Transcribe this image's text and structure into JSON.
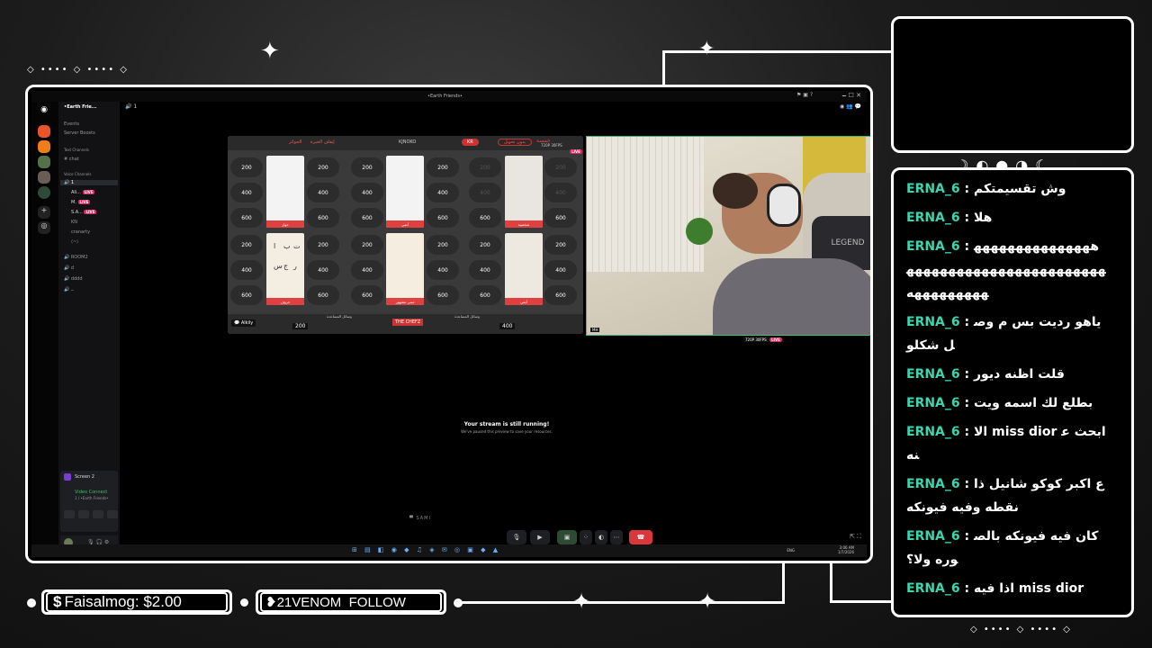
{
  "discord": {
    "window_title": "•Earth Friends•",
    "server_name": "•Earth Frie...",
    "sidebar_items": [
      "Events",
      "Server Boosts"
    ],
    "text_channels_header": "Text Channels",
    "text_channels": [
      "chat"
    ],
    "voice_channels_header": "Voice Channels",
    "voice_channel_active": "1",
    "voice_users": [
      "Ali...",
      "M.",
      "S.A...",
      "KN",
      "cranarty",
      "⟨~⟩"
    ],
    "voice_live_badge": "LIVE",
    "other_voice_channels": [
      "ROOM2",
      "d",
      "dddd",
      "ــ"
    ],
    "header_channel": "1",
    "stream_panel": {
      "screen_label": "Screen 2",
      "video_status": "Video Connect",
      "video_channel": "1 / •Earth Friends•"
    },
    "board": {
      "top_labels": [
        "الجوائز",
        "إيقاف الخبرة",
        "KJNOKO",
        "KR",
        "بدون تحويل"
      ],
      "brand_badge": "خمسة",
      "quality_badge": "720P 30FPS",
      "live_badge": "LIVE",
      "values_rows": [
        [
          "200",
          "200",
          "200",
          "200",
          "200",
          "200"
        ],
        [
          "400",
          "400",
          "400",
          "400",
          "400",
          "400"
        ],
        [
          "600",
          "600",
          "600",
          "600",
          "600",
          "600"
        ],
        [
          "200",
          "200",
          "200",
          "200",
          "200",
          "200"
        ],
        [
          "400",
          "400",
          "400",
          "400",
          "400",
          "400"
        ],
        [
          "600",
          "600",
          "600",
          "600",
          "600",
          "600"
        ]
      ],
      "card_labels": [
        "جهاز",
        "أنمي",
        "شخصية",
        "حروف",
        "مبنى مشهور",
        "أنمي"
      ],
      "grid_letters": [
        "ا",
        "ب",
        "ت",
        "س",
        "ج",
        "ر"
      ],
      "team1_title": "وسائل المساعدة",
      "team1_score": "200",
      "team2_title": "وسائل المساعدة",
      "team2_score": "400",
      "center_logo": "THE CHEFZ",
      "player_tag": "Alkily"
    },
    "cam": {
      "pillow_text": "LEGEND",
      "corner_tag": "MH",
      "quality_badge": "720P 30FPS",
      "live_badge": "LIVE"
    },
    "paused_title": "Your stream is still running!",
    "paused_sub": "We've paused this preview to save your resources.",
    "streamer_tag": "SAMI",
    "taskbar": {
      "lang": "ENG",
      "time": "3:06 AM",
      "date": "1/7/2026"
    }
  },
  "chat": {
    "messages": [
      {
        "user": "ERNA_6",
        "text": "وش تقسيمتكم"
      },
      {
        "user": "ERNA_6",
        "text": "هلا"
      },
      {
        "user": "ERNA_6",
        "text": "ههههههههههههههههههههههههههههههههههههههههههههههههه"
      },
      {
        "user": "ERNA_6",
        "text": "ياهو رديت بس م وصل شكلو"
      },
      {
        "user": "ERNA_6",
        "text": "قلت اظنه ديور"
      },
      {
        "user": "ERNA_6",
        "text": "بطلع لك اسمه ويت"
      },
      {
        "user": "ERNA_6",
        "text": "الا miss dior ابحث عنه"
      },
      {
        "user": "ERNA_6",
        "text": "ع اكبر كوكو شانيل ذا نقطه وفيه فيونكه"
      },
      {
        "user": "ERNA_6",
        "text": "كان فيه فيونكه بالصوره ولا؟"
      },
      {
        "user": "ERNA_6",
        "text": "اذا فيه miss dior"
      }
    ]
  },
  "bottom": {
    "donation": "Faisalmog: $2.00",
    "follow_name": "21VENOM",
    "follow_label": "FOLLOW"
  },
  "colors": {
    "chat_username": "#3ad6b0",
    "live_red": "#e0245e",
    "stream_border": "#3fbf6f",
    "end_call": "#da373c"
  }
}
